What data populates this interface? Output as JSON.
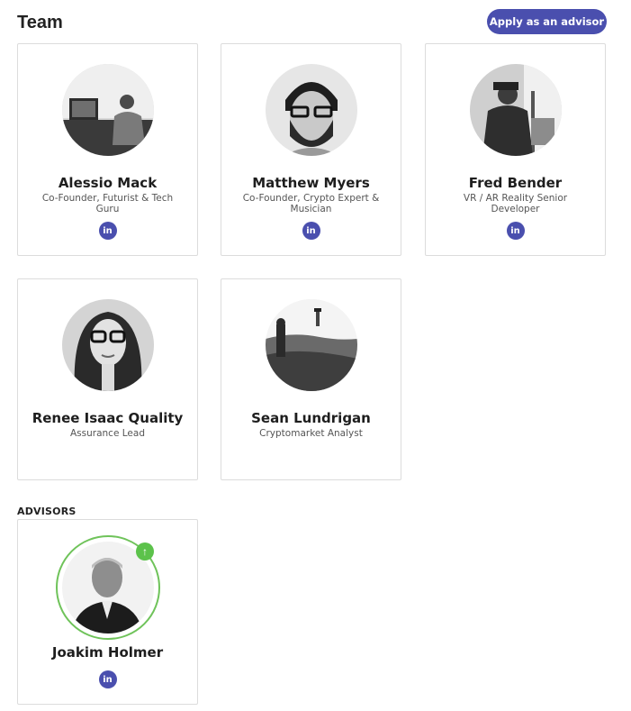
{
  "header": {
    "title": "Team",
    "apply_label": "Apply as an advisor"
  },
  "team": [
    {
      "name": "Alessio Mack",
      "role": "Co-Founder, Futurist & Tech Guru",
      "social": "in"
    },
    {
      "name": "Matthew Myers",
      "role": "Co-Founder, Crypto Expert & Musician",
      "social": "in"
    },
    {
      "name": "Fred Bender",
      "role": "VR / AR Reality Senior Developer",
      "social": "in"
    },
    {
      "name": "Renee Isaac Quality",
      "role": "Assurance Lead"
    },
    {
      "name": "Sean Lundrigan",
      "role": "Cryptomarket Analyst"
    }
  ],
  "advisors": {
    "label": "ADVISORS",
    "items": [
      {
        "name": "Joakim Holmer",
        "social": "in",
        "badge_icon": "arrow-up-icon"
      }
    ]
  },
  "colors": {
    "accent": "#4a4fae",
    "advisor_ring": "#6fc35a",
    "card_border": "#dcdcdc"
  }
}
